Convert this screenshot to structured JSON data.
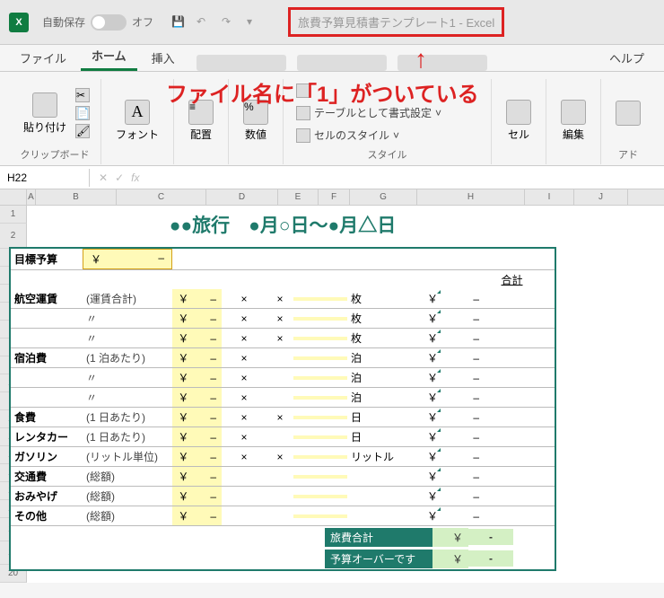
{
  "titlebar": {
    "autosave_label": "自動保存",
    "autosave_state": "オフ",
    "filename": "旅費予算見積書テンプレート1",
    "app": "Excel"
  },
  "annotation": {
    "text": "ファイル名に「1」がついている",
    "arrow": "↑"
  },
  "tabs": {
    "file": "ファイル",
    "home": "ホーム",
    "insert": "挿入",
    "help": "ヘルプ"
  },
  "ribbon": {
    "clipboard": {
      "paste": "貼り付け",
      "label": "クリップボード"
    },
    "font": {
      "btn": "フォント"
    },
    "align": {
      "btn": "配置"
    },
    "number": {
      "btn": "数値"
    },
    "styles": {
      "table_fmt": "テーブルとして書式設定",
      "cell_style": "セルのスタイル",
      "label": "スタイル"
    },
    "cells": {
      "btn": "セル"
    },
    "edit": {
      "btn": "編集"
    },
    "addin": {
      "label": "アド"
    }
  },
  "formula": {
    "name_box": "H22",
    "fx": "fx"
  },
  "cols": [
    "A",
    "B",
    "C",
    "D",
    "E",
    "F",
    "G",
    "H",
    "I",
    "J"
  ],
  "doc": {
    "title": "●●旅行　●月○日～●月△日",
    "goal_label": "目標予算",
    "yen": "￥",
    "dash": "–",
    "times": "×",
    "equals": "＝",
    "total_header": "合計",
    "rows": [
      {
        "cat": "航空運賃",
        "note": "(運賃合計)",
        "yen": true,
        "x": true,
        "x2": true,
        "unit": "枚",
        "cell_yen": true
      },
      {
        "cat": "",
        "note": "〃",
        "yen": true,
        "x": true,
        "x2": true,
        "unit": "枚",
        "cell_yen": true
      },
      {
        "cat": "",
        "note": "〃",
        "yen": true,
        "x": true,
        "x2": true,
        "unit": "枚",
        "cell_yen": true
      },
      {
        "cat": "宿泊費",
        "note": "(1 泊あたり)",
        "yen": true,
        "x": true,
        "x2": false,
        "unit": "泊",
        "cell_yen": true
      },
      {
        "cat": "",
        "note": "〃",
        "yen": true,
        "x": true,
        "x2": false,
        "unit": "泊",
        "cell_yen": true
      },
      {
        "cat": "",
        "note": "〃",
        "yen": true,
        "x": true,
        "x2": false,
        "unit": "泊",
        "cell_yen": true
      },
      {
        "cat": "食費",
        "note": "(1 日あたり)",
        "yen": true,
        "x": true,
        "x2": true,
        "unit": "日",
        "cell_yen": true
      },
      {
        "cat": "レンタカー",
        "note": "(1 日あたり)",
        "yen": true,
        "x": true,
        "x2": false,
        "unit": "日",
        "cell_yen": true
      },
      {
        "cat": "ガソリン",
        "note": "(リットル単位)",
        "yen": true,
        "x": true,
        "x2": true,
        "unit": "リットル",
        "cell_yen": true
      },
      {
        "cat": "交通費",
        "note": "(総額)",
        "yen": true,
        "x": false,
        "x2": false,
        "unit": "",
        "cell_yen": true
      },
      {
        "cat": "おみやげ",
        "note": "(総額)",
        "yen": true,
        "x": false,
        "x2": false,
        "unit": "",
        "cell_yen": true
      },
      {
        "cat": "その他",
        "note": "(総額)",
        "yen": true,
        "x": false,
        "x2": false,
        "unit": "",
        "cell_yen": true
      }
    ],
    "summary": [
      {
        "label": "旅費合計",
        "yen": "￥",
        "val": "-"
      },
      {
        "label": "予算オーバーです",
        "yen": "￥",
        "val": "-"
      }
    ]
  }
}
